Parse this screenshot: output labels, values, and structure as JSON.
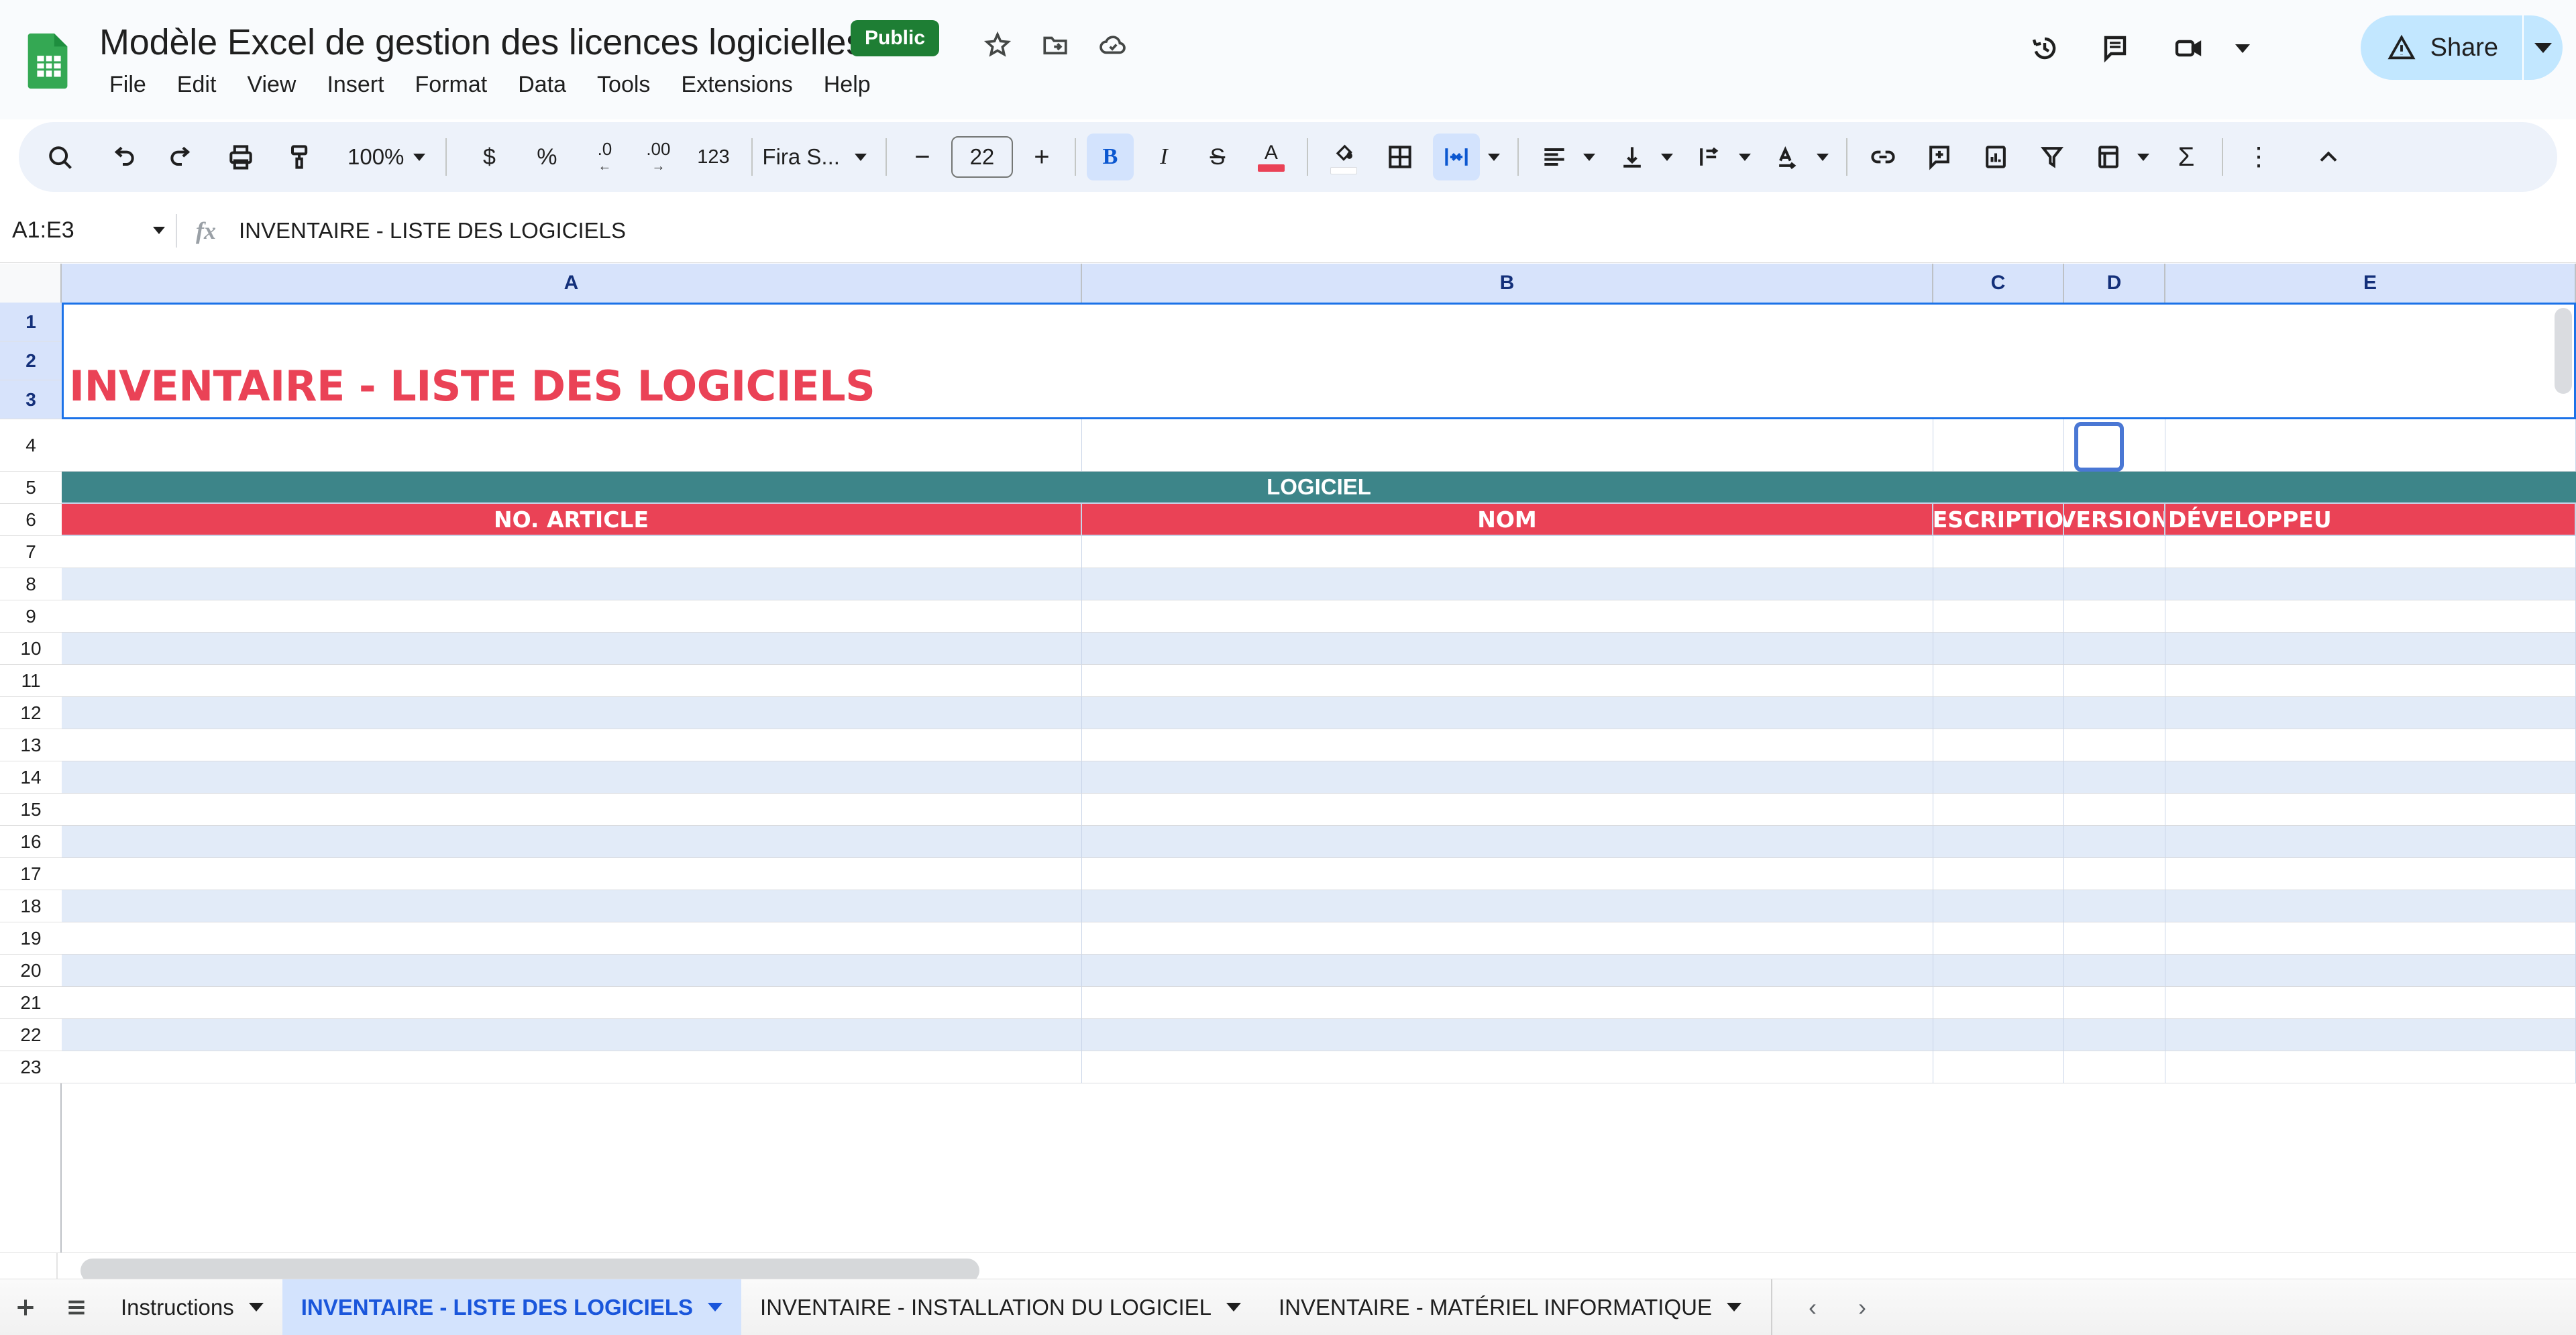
{
  "header": {
    "doc_title": "Modèle Excel de gestion des licences logicielles",
    "visibility_badge": "Public",
    "icons": {
      "app_logo": "sheets-logo-icon",
      "star": "star-icon",
      "move_to_folder": "move-to-folder-icon",
      "cloud_saved": "cloud-saved-icon",
      "version_history": "version-history-icon",
      "comments": "comment-icon",
      "meet": "video-call-icon"
    },
    "menu": [
      "File",
      "Edit",
      "View",
      "Insert",
      "Format",
      "Data",
      "Tools",
      "Extensions",
      "Help"
    ],
    "share_label": "Share"
  },
  "toolbar": {
    "zoom_value": "100%",
    "font_name": "Fira S...",
    "font_size": "22",
    "items": [
      {
        "name": "search-icon",
        "glyph": ""
      },
      {
        "name": "undo-icon",
        "glyph": ""
      },
      {
        "name": "redo-icon",
        "glyph": ""
      },
      {
        "name": "print-icon",
        "glyph": ""
      },
      {
        "name": "paint-format-icon",
        "glyph": ""
      },
      {
        "name": "currency-format-button",
        "glyph": "$"
      },
      {
        "name": "percent-format-button",
        "glyph": "%"
      },
      {
        "name": "decrease-decimal-button",
        "glyph": ".0"
      },
      {
        "name": "increase-decimal-button",
        "glyph": ".00"
      },
      {
        "name": "more-formats-button",
        "glyph": "123"
      },
      {
        "name": "bold-button",
        "glyph": "B"
      },
      {
        "name": "italic-button",
        "glyph": "I"
      },
      {
        "name": "strikethrough-button",
        "glyph": "S"
      },
      {
        "name": "text-color-button",
        "glyph": "A"
      },
      {
        "name": "fill-color-icon",
        "glyph": ""
      },
      {
        "name": "borders-icon",
        "glyph": ""
      },
      {
        "name": "merge-cells-icon",
        "glyph": ""
      },
      {
        "name": "horizontal-align-icon",
        "glyph": ""
      },
      {
        "name": "vertical-align-icon",
        "glyph": ""
      },
      {
        "name": "text-wrapping-icon",
        "glyph": ""
      },
      {
        "name": "text-rotation-icon",
        "glyph": ""
      },
      {
        "name": "insert-link-icon",
        "glyph": ""
      },
      {
        "name": "insert-comment-icon",
        "glyph": ""
      },
      {
        "name": "insert-chart-icon",
        "glyph": ""
      },
      {
        "name": "create-filter-icon",
        "glyph": ""
      },
      {
        "name": "functions-icon",
        "glyph": "Σ"
      },
      {
        "name": "more-options-icon",
        "glyph": "⋮"
      },
      {
        "name": "collapse-toolbar-icon",
        "glyph": "^"
      }
    ],
    "colors": {
      "text_color": "#ea4256",
      "fill_color": "#ffffff"
    }
  },
  "formula_bar": {
    "name_box": "A1:E3",
    "fx_label": "fx",
    "value": "INVENTAIRE - LISTE DES LOGICIELS"
  },
  "grid": {
    "columns": [
      "A",
      "B",
      "C",
      "D",
      "E"
    ],
    "rows": [
      "1",
      "2",
      "3",
      "4",
      "5",
      "6",
      "7",
      "8",
      "9",
      "10",
      "11",
      "12",
      "13",
      "14",
      "15",
      "16",
      "17",
      "18",
      "19",
      "20",
      "21",
      "22",
      "23"
    ],
    "title_cell": "INVENTAIRE - LISTE DES LOGICIELS",
    "group_banner": "LOGICIEL",
    "table_headers": [
      "NO. ARTICLE",
      "NOM",
      "DESCRIPTION",
      "VERSION",
      "DÉVELOPPEU"
    ],
    "selected_range": "A1:E3",
    "active_cell_row": "4",
    "colors": {
      "title_text": "#ea4256",
      "banner_teal": "#3d8589",
      "header_red": "#ea4256",
      "band_blue": "#e2ebf8",
      "selection_blue": "#1b72e8"
    }
  },
  "sheet_tabs": {
    "add_sheet_icon": "add-sheet-icon",
    "all_sheets_icon": "all-sheets-icon",
    "tabs": [
      {
        "label": "Instructions",
        "active": false
      },
      {
        "label": "INVENTAIRE - LISTE DES LOGICIELS",
        "active": true
      },
      {
        "label": "INVENTAIRE - INSTALLATION DU LOGICIEL",
        "active": false
      },
      {
        "label": "INVENTAIRE - MATÉRIEL INFORMATIQUE",
        "active": false
      }
    ],
    "prev_label": "‹",
    "next_label": "›"
  }
}
